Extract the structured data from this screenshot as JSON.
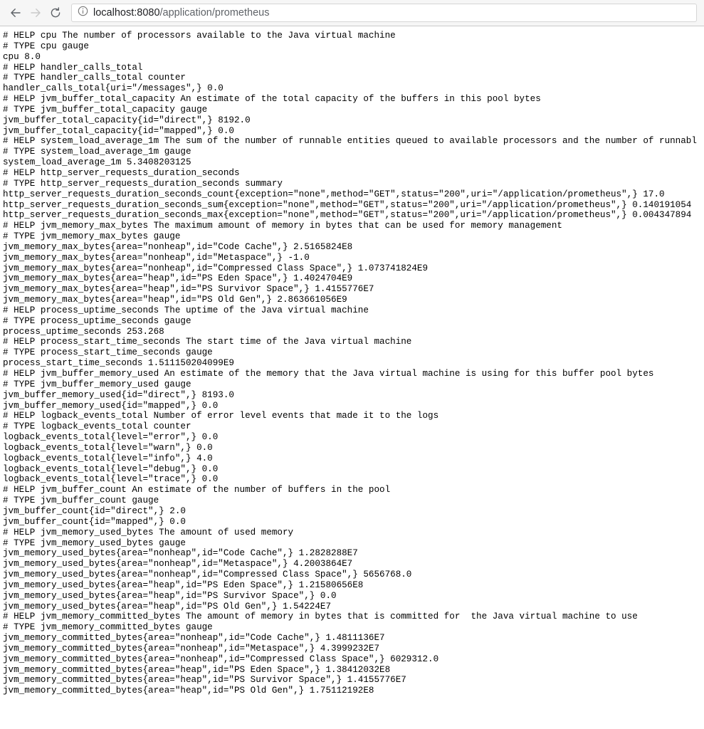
{
  "browser": {
    "back_icon": "arrow-left-icon",
    "forward_icon": "arrow-right-icon",
    "reload_icon": "reload-icon",
    "page_info_icon": "info-circle-icon",
    "url_host": "localhost:8080",
    "url_path": "/application/prometheus",
    "url_full": "localhost:8080/application/prometheus"
  },
  "page": {
    "content_type": "prometheus-metrics-text",
    "lines": [
      "# HELP cpu The number of processors available to the Java virtual machine",
      "# TYPE cpu gauge",
      "cpu 8.0",
      "# HELP handler_calls_total",
      "# TYPE handler_calls_total counter",
      "handler_calls_total{uri=\"/messages\",} 0.0",
      "# HELP jvm_buffer_total_capacity An estimate of the total capacity of the buffers in this pool bytes",
      "# TYPE jvm_buffer_total_capacity gauge",
      "jvm_buffer_total_capacity{id=\"direct\",} 8192.0",
      "jvm_buffer_total_capacity{id=\"mapped\",} 0.0",
      "# HELP system_load_average_1m The sum of the number of runnable entities queued to available processors and the number of runnabl",
      "# TYPE system_load_average_1m gauge",
      "system_load_average_1m 5.3408203125",
      "# HELP http_server_requests_duration_seconds",
      "# TYPE http_server_requests_duration_seconds summary",
      "http_server_requests_duration_seconds_count{exception=\"none\",method=\"GET\",status=\"200\",uri=\"/application/prometheus\",} 17.0",
      "http_server_requests_duration_seconds_sum{exception=\"none\",method=\"GET\",status=\"200\",uri=\"/application/prometheus\",} 0.140191054",
      "http_server_requests_duration_seconds_max{exception=\"none\",method=\"GET\",status=\"200\",uri=\"/application/prometheus\",} 0.004347894",
      "# HELP jvm_memory_max_bytes The maximum amount of memory in bytes that can be used for memory management",
      "# TYPE jvm_memory_max_bytes gauge",
      "jvm_memory_max_bytes{area=\"nonheap\",id=\"Code Cache\",} 2.5165824E8",
      "jvm_memory_max_bytes{area=\"nonheap\",id=\"Metaspace\",} -1.0",
      "jvm_memory_max_bytes{area=\"nonheap\",id=\"Compressed Class Space\",} 1.073741824E9",
      "jvm_memory_max_bytes{area=\"heap\",id=\"PS Eden Space\",} 1.4024704E9",
      "jvm_memory_max_bytes{area=\"heap\",id=\"PS Survivor Space\",} 1.4155776E7",
      "jvm_memory_max_bytes{area=\"heap\",id=\"PS Old Gen\",} 2.863661056E9",
      "# HELP process_uptime_seconds The uptime of the Java virtual machine",
      "# TYPE process_uptime_seconds gauge",
      "process_uptime_seconds 253.268",
      "# HELP process_start_time_seconds The start time of the Java virtual machine",
      "# TYPE process_start_time_seconds gauge",
      "process_start_time_seconds 1.511150204099E9",
      "# HELP jvm_buffer_memory_used An estimate of the memory that the Java virtual machine is using for this buffer pool bytes",
      "# TYPE jvm_buffer_memory_used gauge",
      "jvm_buffer_memory_used{id=\"direct\",} 8193.0",
      "jvm_buffer_memory_used{id=\"mapped\",} 0.0",
      "# HELP logback_events_total Number of error level events that made it to the logs",
      "# TYPE logback_events_total counter",
      "logback_events_total{level=\"error\",} 0.0",
      "logback_events_total{level=\"warn\",} 0.0",
      "logback_events_total{level=\"info\",} 4.0",
      "logback_events_total{level=\"debug\",} 0.0",
      "logback_events_total{level=\"trace\",} 0.0",
      "# HELP jvm_buffer_count An estimate of the number of buffers in the pool",
      "# TYPE jvm_buffer_count gauge",
      "jvm_buffer_count{id=\"direct\",} 2.0",
      "jvm_buffer_count{id=\"mapped\",} 0.0",
      "# HELP jvm_memory_used_bytes The amount of used memory",
      "# TYPE jvm_memory_used_bytes gauge",
      "jvm_memory_used_bytes{area=\"nonheap\",id=\"Code Cache\",} 1.2828288E7",
      "jvm_memory_used_bytes{area=\"nonheap\",id=\"Metaspace\",} 4.2003864E7",
      "jvm_memory_used_bytes{area=\"nonheap\",id=\"Compressed Class Space\",} 5656768.0",
      "jvm_memory_used_bytes{area=\"heap\",id=\"PS Eden Space\",} 1.21580656E8",
      "jvm_memory_used_bytes{area=\"heap\",id=\"PS Survivor Space\",} 0.0",
      "jvm_memory_used_bytes{area=\"heap\",id=\"PS Old Gen\",} 1.54224E7",
      "# HELP jvm_memory_committed_bytes The amount of memory in bytes that is committed for  the Java virtual machine to use",
      "# TYPE jvm_memory_committed_bytes gauge",
      "jvm_memory_committed_bytes{area=\"nonheap\",id=\"Code Cache\",} 1.4811136E7",
      "jvm_memory_committed_bytes{area=\"nonheap\",id=\"Metaspace\",} 4.3999232E7",
      "jvm_memory_committed_bytes{area=\"nonheap\",id=\"Compressed Class Space\",} 6029312.0",
      "jvm_memory_committed_bytes{area=\"heap\",id=\"PS Eden Space\",} 1.38412032E8",
      "jvm_memory_committed_bytes{area=\"heap\",id=\"PS Survivor Space\",} 1.4155776E7",
      "jvm_memory_committed_bytes{area=\"heap\",id=\"PS Old Gen\",} 1.75112192E8"
    ]
  }
}
